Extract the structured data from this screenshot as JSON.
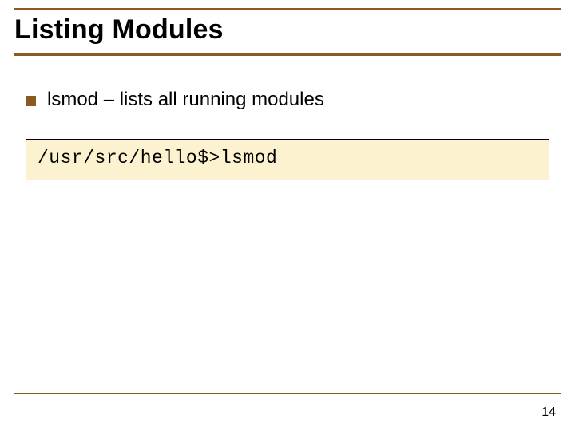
{
  "title": "Listing Modules",
  "bullets": [
    {
      "text": "lsmod – lists all running modules"
    }
  ],
  "codebox": {
    "line": "/usr/src/hello$>lsmod"
  },
  "page_number": "14"
}
